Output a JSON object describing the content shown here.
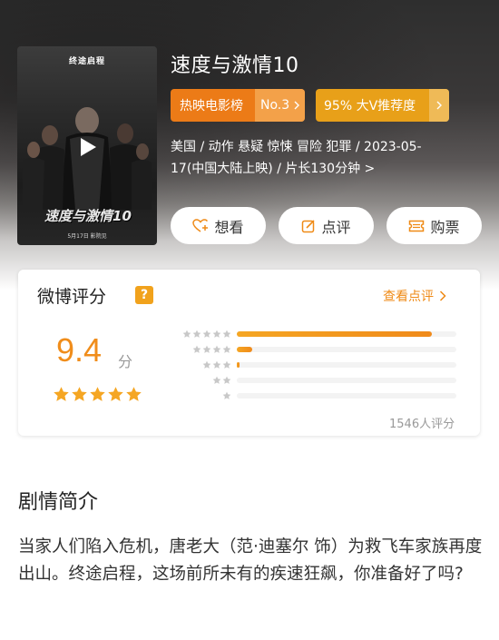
{
  "movie": {
    "title": "速度与激情10",
    "poster": {
      "top_text": "终途启程",
      "logo_text": "速度与激情10",
      "date_text": "5月17日 影院见"
    },
    "rank_badge": {
      "label": "热映电影榜",
      "value": "No.3",
      "icon": "chevron-right-icon"
    },
    "rec_badge": {
      "label": "95% 大V推荐度",
      "icon": "chevron-right-icon"
    },
    "meta_line1": "美国 / 动作 悬疑 惊悚 冒险 犯罪 / 2023-05-",
    "meta_line2": "17(中国大陆上映) / 片长130分钟 >"
  },
  "actions": {
    "want": {
      "label": "想看",
      "icon": "heart-plus-icon"
    },
    "review": {
      "label": "点评",
      "icon": "edit-icon"
    },
    "buy": {
      "label": "购票",
      "icon": "ticket-icon"
    }
  },
  "rating": {
    "title": "微博评分",
    "help_icon": "?",
    "view_reviews": "查看点评",
    "score": "9.4",
    "unit": "分",
    "stars": 5,
    "distribution": [
      {
        "stars": 5,
        "fraction": 0.89
      },
      {
        "stars": 4,
        "fraction": 0.07
      },
      {
        "stars": 3,
        "fraction": 0.01
      },
      {
        "stars": 2,
        "fraction": 0.0
      },
      {
        "stars": 1,
        "fraction": 0.0
      }
    ],
    "count": "1546人评分"
  },
  "synopsis": {
    "title": "剧情简介",
    "text": "当家人们陷入危机，唐老大（范·迪塞尔 饰）为救飞车家族再度出山。终途启程，这场前所未有的疾速狂飙，你准备好了吗?"
  },
  "colors": {
    "accent": "#f08d1b",
    "rank_badge": "#ec7b17",
    "rec_badge": "#e8a019",
    "star": "#f5a623"
  }
}
